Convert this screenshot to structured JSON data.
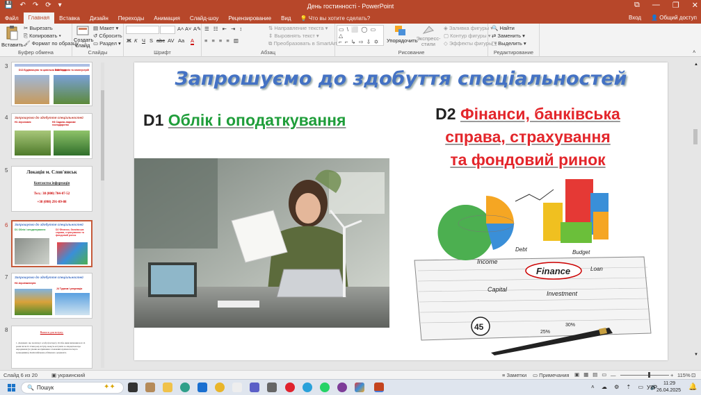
{
  "titlebar": {
    "title": "День гостинності - PowerPoint",
    "quick_access": [
      "💾",
      "↶",
      "↷",
      "⟳",
      "▾"
    ],
    "window_controls": [
      "⧉",
      "—",
      "❐",
      "✕"
    ]
  },
  "tabs": [
    "Файл",
    "Главная",
    "Вставка",
    "Дизайн",
    "Переходы",
    "Анимация",
    "Слайд-шоу",
    "Рецензирование",
    "Вид"
  ],
  "tell_me": "Что вы хотите сделать?",
  "account": {
    "signin": "Вход",
    "share": "Общий доступ"
  },
  "ribbon": {
    "clipboard": {
      "label": "Буфер обмена",
      "paste": "Вставить",
      "cut": "Вырезать",
      "copy": "Копировать",
      "format": "Формат по образцу"
    },
    "slides": {
      "label": "Слайды",
      "new": "Создать слайд",
      "layout": "Макет",
      "reset": "Сбросить",
      "section": "Раздел"
    },
    "font": {
      "label": "Шрифт",
      "bold": "Ж",
      "italic": "К",
      "underline": "Ч",
      "strike": "S",
      "shadow": "abc",
      "spacing": "AV",
      "case": "Aa",
      "grow": "A˄",
      "shrink": "A˅",
      "clear": "A✎",
      "color": "A"
    },
    "paragraph": {
      "label": "Абзац",
      "direction": "Направление текста",
      "align": "Выровнять текст",
      "smartart": "Преобразовать в SmartArt"
    },
    "drawing": {
      "label": "Рисование",
      "arrange": "Упорядочить",
      "quick_styles": "Экспресс-стили",
      "fill": "Заливка фигуры",
      "outline": "Контур фигуры",
      "effects": "Эффекты фигуры"
    },
    "editing": {
      "label": "Редактирование",
      "find": "Найти",
      "replace": "Заменить",
      "select": "Выделить"
    },
    "shapes_rows": [
      "▭ \\ ⬜ ◯ ▭ △",
      "⌐ ⌐ ↳ ⇨ ⇩ ✡",
      "⌇ ⌒ ◠ { } ☆"
    ]
  },
  "thumbnails": [
    {
      "num": "3",
      "text_a": "D13 Будівництво та цивільна інженерія",
      "text_b": "D15 Геодезія та землеустрій"
    },
    {
      "num": "4",
      "title": "Запрошуємо до здобуття спеціальностей",
      "text_a": "H1 Агрономія",
      "text_b": "H3 Садово-паркове господарство"
    },
    {
      "num": "5",
      "title": "Локація м. Слов'янськ",
      "sub": "Контактна інформація",
      "tel1": "Тел.: 38 (000) 704-07-52",
      "tel2": "+38 (098) 291-89-88"
    },
    {
      "num": "6",
      "title": "Запрошуємо до здобуття спеціальностей",
      "text_a": "D1 Облік і оподаткування",
      "text_b": "D2 Фінанси, банківська справа, страхування та фондовий ринок"
    },
    {
      "num": "7",
      "title": "Запрошуємо до здобуття спеціальностей",
      "text_a": "H4 Агроінженерія",
      "text_b": "J4 Туризм і рекреація"
    },
    {
      "num": "8",
      "title": "Вимоги для вступу:",
      "body": "1. Документ, що посвідчує особу (паспорт). Особи, яким виповнилося 14 років після 01 січня року вступу, можуть вступати за свідоцтвом про народження (за умови неотримання з поважних причин паспорта громадянина). Копія військово-облікового документа."
    }
  ],
  "slide": {
    "title": "Запрошуємо до здобуття спеціальностей",
    "left_code": "D1",
    "left_text": "Облік і оподаткування",
    "right_code": "D2",
    "right_line1": "Фінанси, банківська",
    "right_line2": "справа, страхування",
    "right_line3": "та фондовий ринок",
    "finance_words": {
      "center": "Finance",
      "debt": "Debt",
      "income": "Income",
      "budget": "Budget",
      "loan": "Loan",
      "capital": "Capital",
      "investment": "Investment",
      "n45": "45",
      "p25": "25%",
      "p30": "30%"
    }
  },
  "status": {
    "slide": "Слайд 6 из 20",
    "lang": "украинский",
    "notes": "Заметки",
    "comments": "Примечания",
    "zoom": "115%"
  },
  "taskbar": {
    "search": "Пошук",
    "lang": "УКР",
    "time": "11:29",
    "date": "26.04.2025"
  },
  "colors": {
    "accent": "#b7472a",
    "title_blue": "#4472c4",
    "green": "#1f9d3a",
    "red": "#e3262b"
  }
}
